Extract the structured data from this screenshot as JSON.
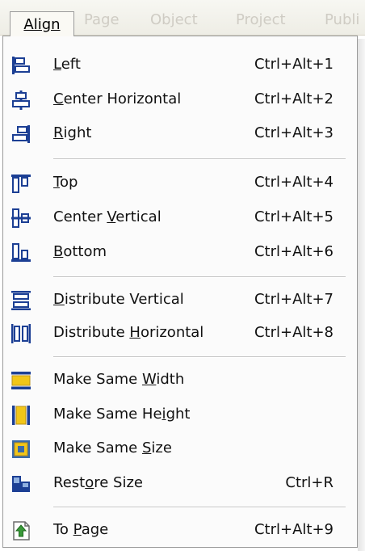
{
  "menubar": {
    "items": [
      {
        "label": "Align"
      },
      {
        "label": "Page"
      },
      {
        "label": "Object"
      },
      {
        "label": "Project"
      },
      {
        "label": "Publi"
      }
    ]
  },
  "menu": {
    "items": [
      {
        "pre": "",
        "u": "L",
        "post": "eft",
        "shortcut": "Ctrl+Alt+1"
      },
      {
        "pre": "",
        "u": "C",
        "post": "enter Horizontal",
        "shortcut": "Ctrl+Alt+2"
      },
      {
        "pre": "",
        "u": "R",
        "post": "ight",
        "shortcut": "Ctrl+Alt+3"
      },
      {
        "pre": "",
        "u": "T",
        "post": "op",
        "shortcut": "Ctrl+Alt+4"
      },
      {
        "pre": "Center ",
        "u": "V",
        "post": "ertical",
        "shortcut": "Ctrl+Alt+5"
      },
      {
        "pre": "",
        "u": "B",
        "post": "ottom",
        "shortcut": "Ctrl+Alt+6"
      },
      {
        "pre": "",
        "u": "D",
        "post": "istribute Vertical",
        "shortcut": "Ctrl+Alt+7"
      },
      {
        "pre": "Distribute ",
        "u": "H",
        "post": "orizontal",
        "shortcut": "Ctrl+Alt+8"
      },
      {
        "pre": "Make Same ",
        "u": "W",
        "post": "idth",
        "shortcut": ""
      },
      {
        "pre": "Make Same He",
        "u": "i",
        "post": "ght",
        "shortcut": ""
      },
      {
        "pre": "Make Same ",
        "u": "S",
        "post": "ize",
        "shortcut": ""
      },
      {
        "pre": "Rest",
        "u": "o",
        "post": "re Size",
        "shortcut": "Ctrl+R"
      },
      {
        "pre": "To ",
        "u": "P",
        "post": "age",
        "shortcut": "Ctrl+Alt+9"
      }
    ]
  },
  "icons": {
    "align-left": "align-left-icon",
    "center-h": "align-center-horizontal-icon",
    "align-right": "align-right-icon",
    "align-top": "align-top-icon",
    "center-v": "align-center-vertical-icon",
    "align-bottom": "align-bottom-icon",
    "dist-v": "distribute-vertical-icon",
    "dist-h": "distribute-horizontal-icon",
    "same-width": "same-width-icon",
    "same-height": "same-height-icon",
    "same-size": "same-size-icon",
    "restore": "restore-size-icon",
    "to-page": "to-page-icon"
  },
  "colors": {
    "icon_blue": "#1c3f94",
    "icon_yellow": "#f2c619",
    "icon_green": "#3a9a3a",
    "separator": "#c6c6c6"
  }
}
